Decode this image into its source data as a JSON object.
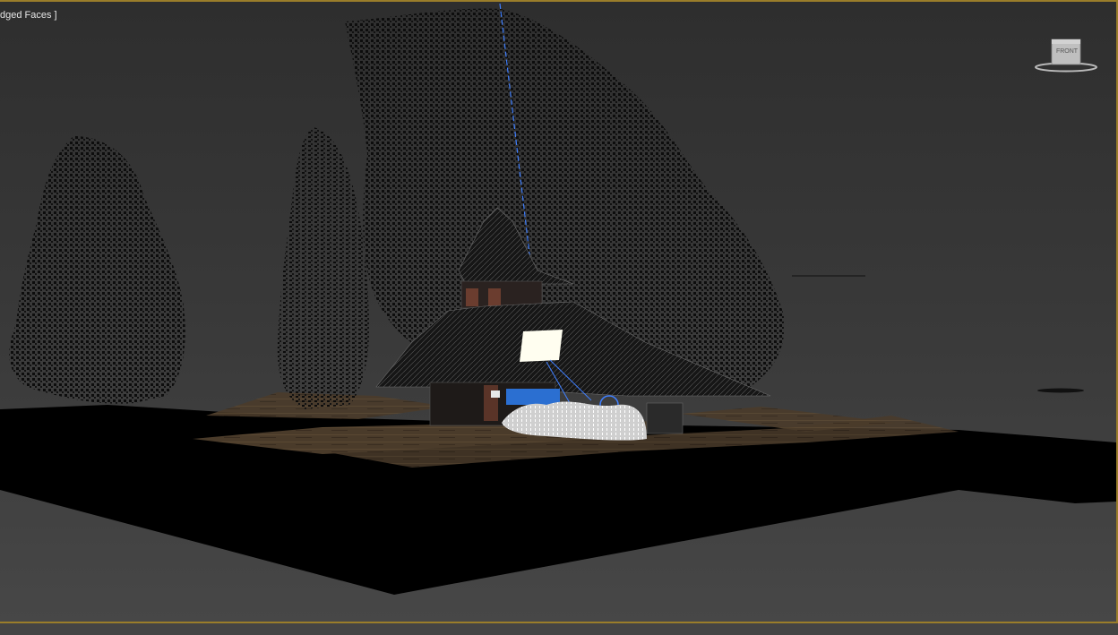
{
  "viewport": {
    "label": "dged Faces ]",
    "border_color": "#9a7d2a",
    "background_color": "#3a3a3a"
  },
  "viewcube": {
    "face_label": "FRONT",
    "icon": "viewcube-icon"
  },
  "scene": {
    "objects": [
      "tree-left",
      "tree-mid",
      "tree-large",
      "pagoda-building",
      "light-panel",
      "vegetation",
      "ground-platform",
      "light-ray"
    ],
    "light_color": "#fffef0",
    "selection_color": "#3f7fff"
  }
}
